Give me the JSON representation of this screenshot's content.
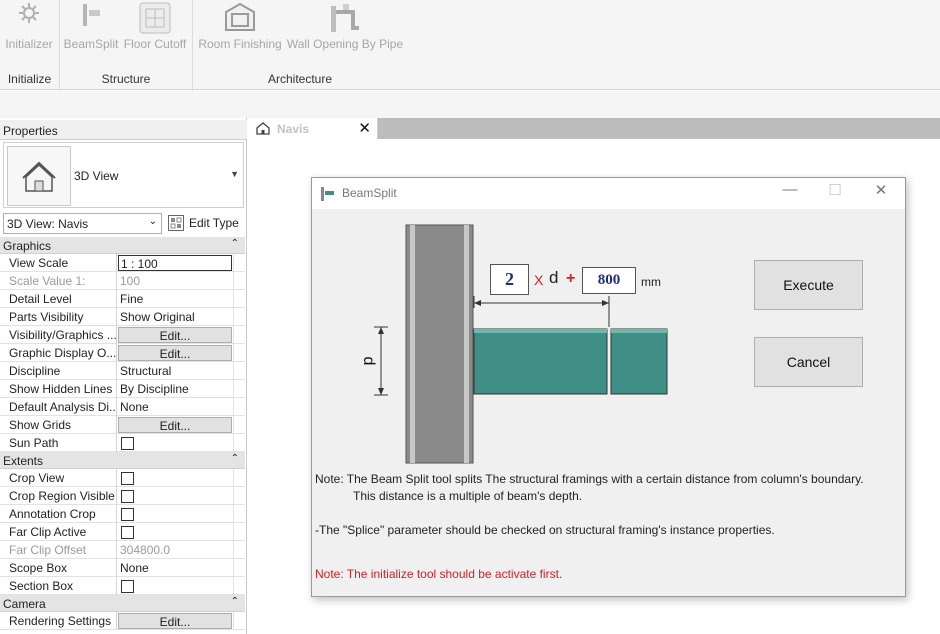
{
  "ribbon": {
    "buttons": [
      {
        "label": "Initializer",
        "icon": "gear-icon"
      },
      {
        "label": "BeamSplit",
        "icon": "beam-split-icon"
      },
      {
        "label": "Floor Cutoff",
        "icon": "floor-cutoff-icon"
      },
      {
        "label": "Room Finishing",
        "icon": "room-finishing-icon"
      },
      {
        "label": "Wall Opening By Pipe",
        "icon": "wall-opening-icon"
      }
    ],
    "groups": [
      "Initialize",
      "Structure",
      "Architecture"
    ]
  },
  "properties": {
    "title": "Properties",
    "type_name": "3D View",
    "instance_selector": "3D View: Navis",
    "edit_type_label": "Edit Type",
    "categories": [
      {
        "name": "Graphics",
        "toggle": "⌃"
      },
      {
        "name": "Extents",
        "toggle": "⌃"
      },
      {
        "name": "Camera",
        "toggle": "⌃"
      }
    ],
    "graphics_rows": [
      {
        "name": "View Scale",
        "value": "1 : 100"
      },
      {
        "name": "Scale Value    1:",
        "value": "100"
      },
      {
        "name": "Detail Level",
        "value": "Fine"
      },
      {
        "name": "Parts Visibility",
        "value": "Show Original"
      },
      {
        "name": "Visibility/Graphics ...",
        "value": "Edit..."
      },
      {
        "name": "Graphic Display O...",
        "value": "Edit..."
      },
      {
        "name": "Discipline",
        "value": "Structural"
      },
      {
        "name": "Show Hidden Lines",
        "value": "By Discipline"
      },
      {
        "name": "Default Analysis Di...",
        "value": "None"
      },
      {
        "name": "Show Grids",
        "value": "Edit..."
      },
      {
        "name": "Sun Path",
        "value": ""
      }
    ],
    "extents_rows": [
      {
        "name": "Crop View",
        "value": ""
      },
      {
        "name": "Crop Region Visible",
        "value": ""
      },
      {
        "name": "Annotation Crop",
        "value": ""
      },
      {
        "name": "Far Clip Active",
        "value": ""
      },
      {
        "name": "Far Clip Offset",
        "value": "304800.0"
      },
      {
        "name": "Scope Box",
        "value": "None"
      },
      {
        "name": "Section Box",
        "value": ""
      }
    ],
    "camera_rows": [
      {
        "name": "Rendering Settings",
        "value": "Edit..."
      }
    ]
  },
  "view_tab": {
    "name": "Navis",
    "close": "✕"
  },
  "dialog": {
    "title": "BeamSplit",
    "window_controls": {
      "minimize": "—",
      "maximize": "☐",
      "close": "✕"
    },
    "multiplier": "2",
    "times": "X",
    "d_symbol": "d",
    "plus": "+",
    "offset": "800",
    "unit": "mm",
    "depth_label": "d",
    "execute_label": "Execute",
    "cancel_label": "Cancel",
    "note_line1": "Note:  The Beam Split tool splits The structural framings with a certain distance from column's boundary.",
    "note_line2": "This distance is a multiple of beam's depth.",
    "note_splice": "-The \"Splice\" parameter should be checked on structural framing's instance properties.",
    "note_init": "Note: The initialize tool should be activate first."
  },
  "colors": {
    "beam": "#3f8f86",
    "column": "#8a8a8a",
    "warning": "#d0202a",
    "multiplier_text": "#1f2d7a"
  }
}
